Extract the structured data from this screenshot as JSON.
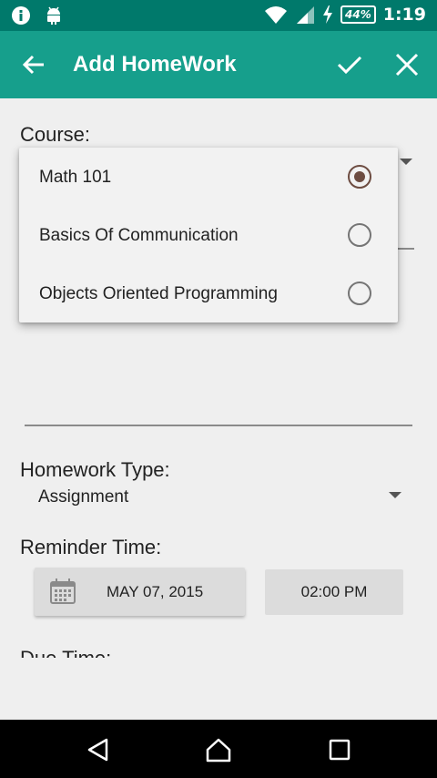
{
  "status_bar": {
    "time": "1:19",
    "battery": "44%",
    "icons": [
      "info-icon",
      "android-icon",
      "wifi-icon",
      "signal-icon",
      "charging-icon",
      "battery-icon"
    ]
  },
  "toolbar": {
    "title": "Add HomeWork",
    "icons": [
      "back-arrow-icon",
      "check-icon",
      "close-icon"
    ]
  },
  "form": {
    "course_label": "Course:",
    "homework_type_label": "Homework Type:",
    "homework_type_value": "Assignment",
    "reminder_time_label": "Reminder Time:",
    "reminder_date": "MAY 07, 2015",
    "reminder_time": "02:00 PM",
    "due_time_label": "Due Time:"
  },
  "course_popup": {
    "options": [
      {
        "label": "Math 101",
        "selected": true
      },
      {
        "label": "Basics Of Communication",
        "selected": false
      },
      {
        "label": "Objects Oriented Programming",
        "selected": false
      }
    ]
  },
  "colors": {
    "status_bar": "#00796b",
    "toolbar": "#169f8c",
    "background": "#efefef",
    "radio_selected": "#6d4c41"
  }
}
